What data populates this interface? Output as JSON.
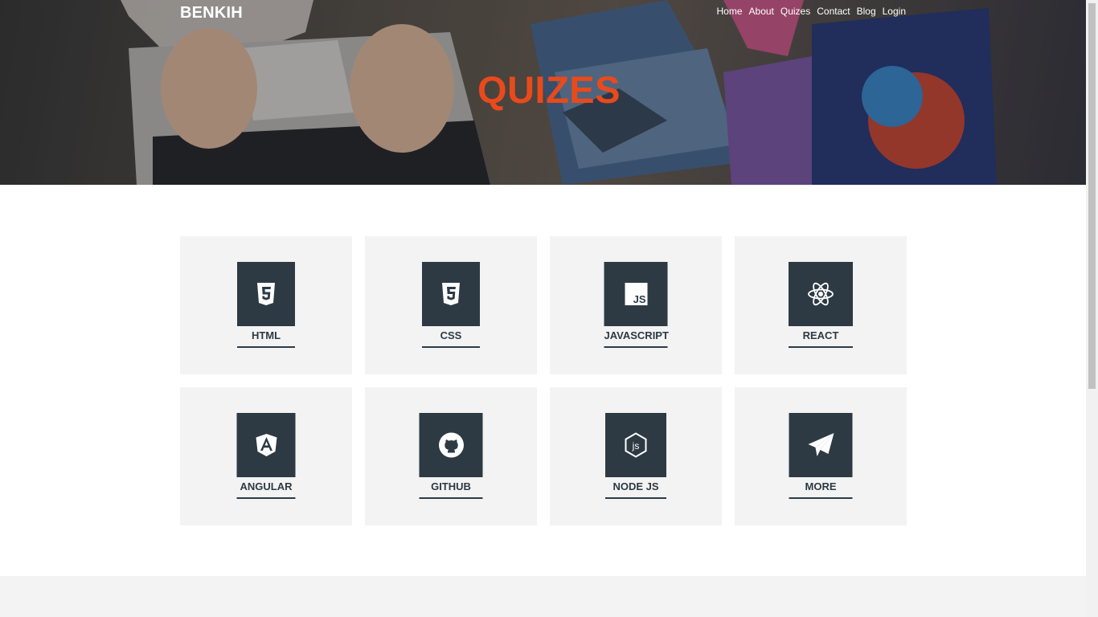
{
  "header": {
    "brand": "BENKIH",
    "nav": [
      "Home",
      "About",
      "Quizes",
      "Contact",
      "Blog",
      "Login"
    ],
    "title": "QUIZES"
  },
  "cards": [
    {
      "label": "HTML",
      "icon": "html5-icon"
    },
    {
      "label": "CSS",
      "icon": "css3-icon"
    },
    {
      "label": "JAVASCRIPT",
      "icon": "js-icon"
    },
    {
      "label": "REACT",
      "icon": "react-icon"
    },
    {
      "label": "ANGULAR",
      "icon": "angular-icon"
    },
    {
      "label": "GITHUB",
      "icon": "github-icon"
    },
    {
      "label": "NODE JS",
      "icon": "nodejs-icon"
    },
    {
      "label": "MORE",
      "icon": "paper-plane-icon"
    }
  ],
  "colors": {
    "title": "#e94a1b",
    "tile": "#2d3a44",
    "card_bg": "#f3f3f3"
  }
}
